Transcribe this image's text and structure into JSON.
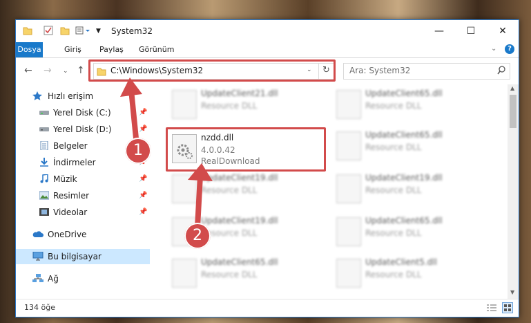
{
  "window": {
    "title": "System32",
    "controls": {
      "minimize": "—",
      "maximize": "☐",
      "close": "✕"
    }
  },
  "ribbon": {
    "tabs": [
      "Dosya",
      "Giriş",
      "Paylaş",
      "Görünüm"
    ]
  },
  "navigation": {
    "address": "C:\\Windows\\System32",
    "search_placeholder": "Ara: System32"
  },
  "sidebar": {
    "quick_access": "Hızlı erişim",
    "items": [
      {
        "label": "Yerel Disk (C:)",
        "icon": "drive-icon",
        "pinned": true
      },
      {
        "label": "Yerel Disk (D:)",
        "icon": "drive-icon",
        "pinned": true
      },
      {
        "label": "Belgeler",
        "icon": "documents-icon",
        "pinned": true
      },
      {
        "label": "İndirmeler",
        "icon": "downloads-icon",
        "pinned": true
      },
      {
        "label": "Müzik",
        "icon": "music-icon",
        "pinned": true
      },
      {
        "label": "Resimler",
        "icon": "pictures-icon",
        "pinned": true
      },
      {
        "label": "Videolar",
        "icon": "videos-icon",
        "pinned": true
      }
    ],
    "onedrive": "OneDrive",
    "this_pc": "Bu bilgisayar",
    "network": "Ağ"
  },
  "files": {
    "left_column": [
      {
        "name": "UpdateClient21.dll",
        "desc": "Resource DLL"
      },
      {
        "name": "nzdd.dll",
        "version": "4.0.0.42",
        "company": "RealDownload",
        "selected": true
      },
      {
        "name": "UpdateClient19.dll",
        "desc": "Resource DLL"
      },
      {
        "name": "UpdateClient19.dll",
        "desc": "Resource DLL"
      },
      {
        "name": "UpdateClient65.dll",
        "desc": "Resource DLL"
      }
    ],
    "right_column": [
      {
        "name": "UpdateClient65.dll",
        "desc": "Resource DLL"
      },
      {
        "name": "UpdateClient65.dll",
        "desc": "Resource DLL"
      },
      {
        "name": "UpdateClient19.dll",
        "desc": "Resource DLL"
      },
      {
        "name": "UpdateClient65.dll",
        "desc": "Resource DLL"
      },
      {
        "name": "UpdateClient5.dll",
        "desc": "Resource DLL"
      }
    ]
  },
  "status": {
    "item_count": "134 öğe"
  },
  "annotations": {
    "marker1": "1",
    "marker2": "2",
    "color": "#d24b4b"
  }
}
